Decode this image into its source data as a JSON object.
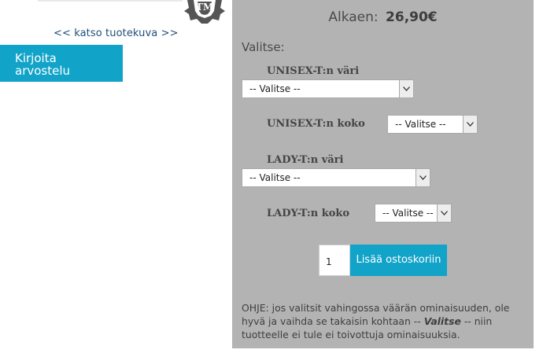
{
  "left": {
    "view_link": "<< katso tuotekuva >>",
    "review_button": "Kirjoita arvostelu"
  },
  "panel": {
    "price_prefix": "Alkaen:",
    "price_value": "26,90€",
    "choose_label": "Valitse:",
    "options": [
      {
        "label": "UNISEX-T:n väri",
        "value": "-- Valitse --"
      },
      {
        "label": "UNISEX-T:n koko",
        "value": "-- Valitse --"
      },
      {
        "label": "LADY-T:n väri",
        "value": "-- Valitse --"
      },
      {
        "label": "LADY-T:n koko",
        "value": "-- Valitse --"
      }
    ],
    "quantity": "1",
    "add_to_cart": "Lisää ostoskoriin",
    "help": {
      "before": "OHJE: jos valitsit vahingossa väärän ominaisuuden, ole hyvä ja vaihda se takaisin kohtaan -- ",
      "emphasis": "Valitse",
      "after": " -- niin tuotteelle ei tule ei toivottuja ominaisuuksia."
    }
  }
}
